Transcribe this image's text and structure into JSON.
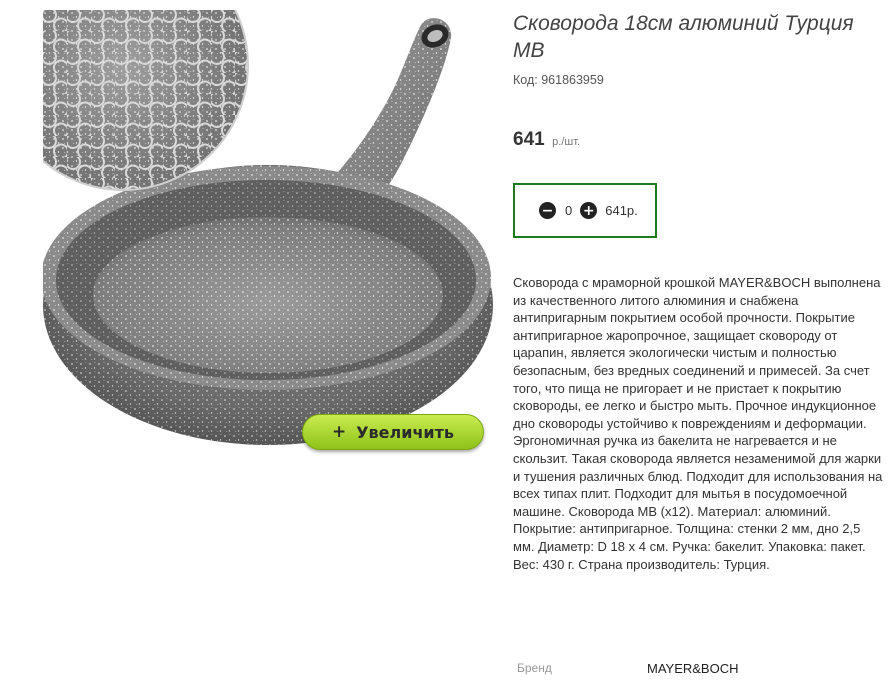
{
  "product": {
    "title": "Сковорода 18см алюминий Турция MB",
    "code_label": "Код:",
    "code": "961863959",
    "price": "641",
    "price_unit": "р./шт."
  },
  "zoom": {
    "plus": "+",
    "label": "Увеличить"
  },
  "quantity": {
    "minus_icon": "minus-circle-icon",
    "plus_icon": "plus-circle-icon",
    "value": "0",
    "total": "641р.",
    "border_color": "#1d7a1d"
  },
  "description": "Сковорода с мраморной крошкой MAYER&BOCH выполнена из качественного литого алюминия и снабжена антипригарным покрытием особой прочности. Покрытие антипригарное жаропрочное, защищает сковороду от царапин, является экологически чистым и полностью безопасным, без вредных соединений и примесей. За счет того, что пища не пригорает и не пристает к покрытию сковороды, ее легко и быстро мыть. Прочное индукционное дно сковороды устойчиво к повреждениям и деформации. Эргономичная ручка из бакелита не нагревается и не скользит. Такая сковорода является незаменимой для жарки и тушения различных блюд. Подходит для использования на всех типах плит. Подходит для мытья в посудомоечной машине. Сковорода MB (x12). Материал: алюминий. Покрытие: антипригарное. Толщина: стенки 2 мм, дно 2,5 мм. Диаметр: D 18 х 4 см. Ручка: бакелит. Упаковка: пакет. Вес: 430 г. Страна производитель: Турция.",
  "brand": {
    "label": "Бренд",
    "value": "MAYER&BOCH"
  },
  "colors": {
    "accent_green": "#8fc21a",
    "pan_gray": "#8c8c8c"
  }
}
